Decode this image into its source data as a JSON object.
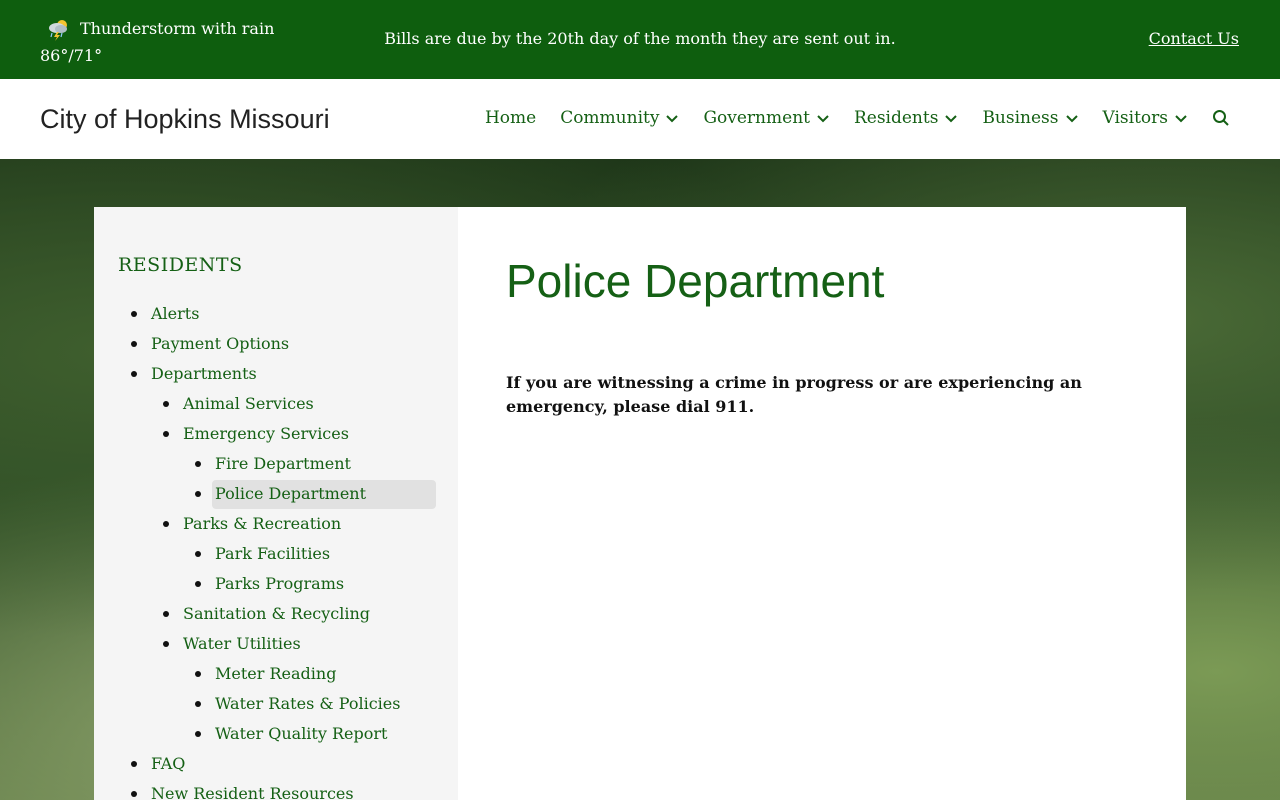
{
  "topbar": {
    "weather_condition": "Thunderstorm with rain",
    "weather_temps": "86°/71°",
    "weather_icon": "thunderstorm-icon",
    "announcement": "Bills are due by the 20th day of the month they are sent out in.",
    "contact_label": "Contact Us"
  },
  "header": {
    "site_title": "City of Hopkins Missouri",
    "nav": [
      {
        "label": "Home",
        "has_dropdown": false
      },
      {
        "label": "Community",
        "has_dropdown": true
      },
      {
        "label": "Government",
        "has_dropdown": true
      },
      {
        "label": "Residents",
        "has_dropdown": true
      },
      {
        "label": "Business",
        "has_dropdown": true
      },
      {
        "label": "Visitors",
        "has_dropdown": true
      }
    ],
    "search_icon": "search-icon"
  },
  "sidebar": {
    "heading": "RESIDENTS",
    "items": [
      {
        "label": "Alerts",
        "level": 0
      },
      {
        "label": "Payment Options",
        "level": 0
      },
      {
        "label": "Departments",
        "level": 0
      },
      {
        "label": "Animal Services",
        "level": 1
      },
      {
        "label": "Emergency Services",
        "level": 1
      },
      {
        "label": "Fire Department",
        "level": 2
      },
      {
        "label": "Police Department",
        "level": 2,
        "active": true
      },
      {
        "label": "Parks & Recreation",
        "level": 1
      },
      {
        "label": "Park Facilities",
        "level": 2
      },
      {
        "label": "Parks Programs",
        "level": 2
      },
      {
        "label": "Sanitation & Recycling",
        "level": 1
      },
      {
        "label": "Water Utilities",
        "level": 1
      },
      {
        "label": "Meter Reading",
        "level": 2
      },
      {
        "label": "Water Rates & Policies",
        "level": 2
      },
      {
        "label": "Water Quality Report",
        "level": 2
      },
      {
        "label": "FAQ",
        "level": 0
      },
      {
        "label": "New Resident Resources",
        "level": 0
      }
    ]
  },
  "content": {
    "title": "Police Department",
    "body": "If you are witnessing a crime in progress or are experiencing an emergency, please dial 911."
  },
  "colors": {
    "topbar_bg": "#0e5e0e",
    "link_green": "#156015",
    "sidebar_bg": "#f5f5f5",
    "active_bg": "#e1e1e1"
  }
}
